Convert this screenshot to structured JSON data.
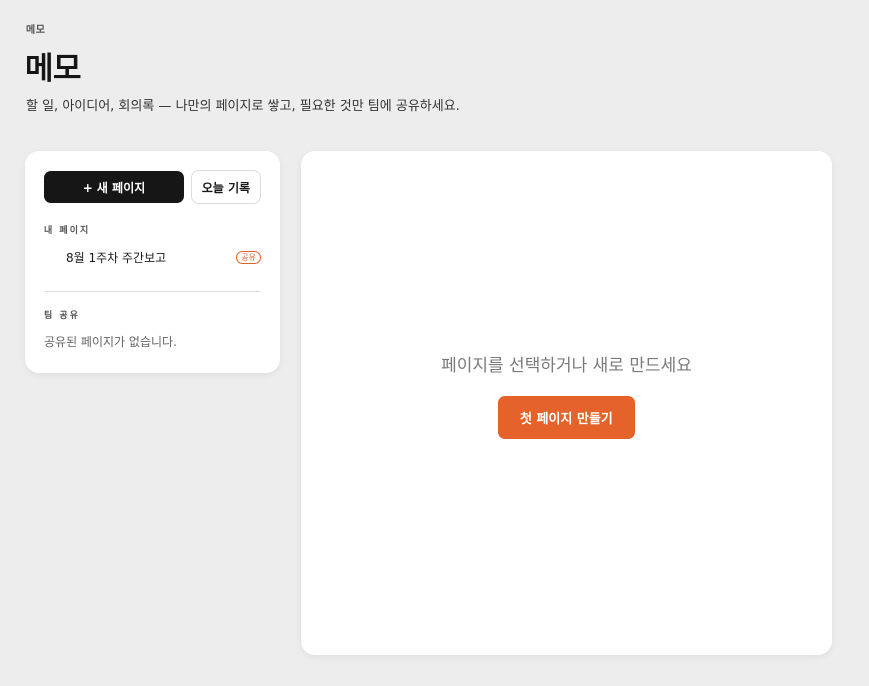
{
  "header": {
    "eyebrow": "메모",
    "title": "메모",
    "subtitle": "할 일, 아이디어, 회의록 — 나만의 페이지로 쌓고, 필요한 것만 팀에 공유하세요."
  },
  "sidebar": {
    "new_page_label": "+ 새 페이지",
    "today_log_label": "오늘 기록",
    "my_pages_label": "내 페이지",
    "my_pages": [
      {
        "title": "8월 1주차 주간보고",
        "badge": "공유"
      }
    ],
    "team_shared_label": "팀 공유",
    "team_empty_text": "공유된 페이지가 없습니다."
  },
  "main": {
    "empty_text": "페이지를 선택하거나 새로 만드세요",
    "create_first_label": "첫 페이지 만들기"
  },
  "colors": {
    "accent": "#e5632a",
    "primary_button": "#161616",
    "background": "#ededed",
    "card": "#ffffff"
  }
}
